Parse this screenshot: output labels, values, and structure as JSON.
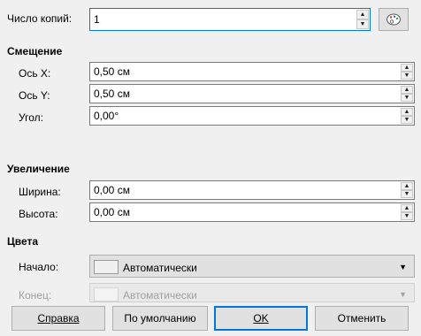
{
  "copies": {
    "label": "Число копий:",
    "value": "1",
    "palette_button_icon": "palette-icon"
  },
  "offset": {
    "title": "Смещение",
    "x_label": "Ось X:",
    "x_value": "0,50 см",
    "y_label": "Ось Y:",
    "y_value": "0,50 см",
    "angle_label": "Угол:",
    "angle_value": "0,00°"
  },
  "enlargement": {
    "title": "Увеличение",
    "width_label": "Ширина:",
    "width_value": "0,00 см",
    "height_label": "Высота:",
    "height_value": "0,00 см"
  },
  "colors": {
    "title": "Цвета",
    "start_label": "Начало:",
    "start_value": "Автоматически",
    "end_label": "Конец:",
    "end_value": "Автоматически"
  },
  "buttons": {
    "help": "Справка",
    "default": "По умолчанию",
    "ok": "OK",
    "cancel": "Отменить"
  },
  "colors_theme": {
    "accent": "#0078d7",
    "focus_border": "#0078d7"
  }
}
